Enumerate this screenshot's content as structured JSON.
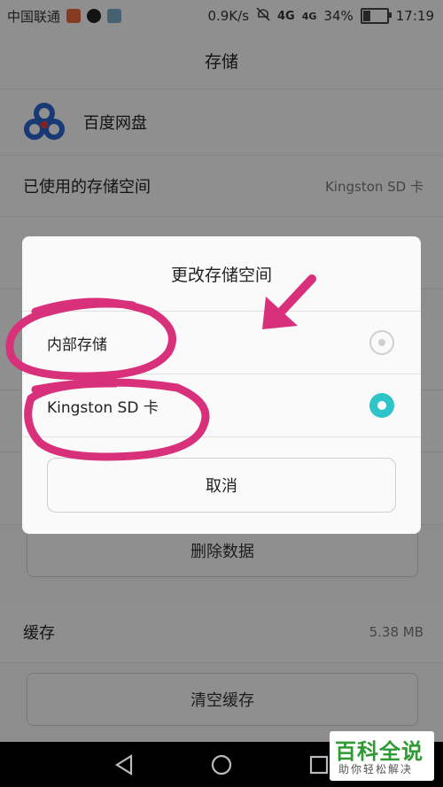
{
  "status_bar": {
    "carrier": "中国联通",
    "net_speed": "0.9K/s",
    "signal_label_1": "4G",
    "signal_label_2": "4G",
    "battery": "34%",
    "time": "17:19"
  },
  "page": {
    "title": "存储",
    "app_name": "百度网盘",
    "storage_used_label": "已使用的存储空间",
    "storage_used_value": "Kingston SD 卡",
    "delete_data_button": "删除数据",
    "cache_label": "缓存",
    "cache_value": "5.38 MB",
    "clear_cache_button": "清空缓存"
  },
  "dialog": {
    "title": "更改存储空间",
    "options": [
      {
        "label": "内部存储",
        "selected": false
      },
      {
        "label": "Kingston SD 卡",
        "selected": true
      }
    ],
    "cancel_label": "取消"
  },
  "watermark": {
    "main": "百科全说",
    "sub": "助你轻松解决"
  },
  "colors": {
    "accent_radio": "#2ec4c8",
    "annotation": "#d8307a",
    "watermark_green": "#2f9a34"
  },
  "icons": [
    "notification-icon",
    "qq-icon",
    "image-icon",
    "mute-icon",
    "battery-charging-icon",
    "baidu-netdisk-icon",
    "back-icon",
    "home-icon",
    "recents-icon"
  ]
}
